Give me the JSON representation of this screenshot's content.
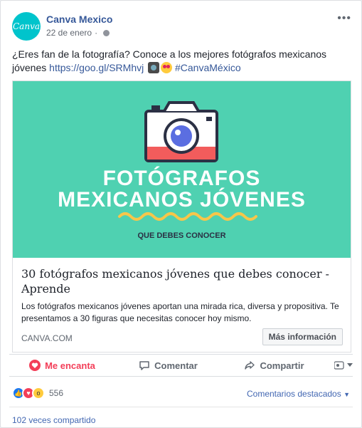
{
  "post": {
    "page_name": "Canva Mexico",
    "avatar_text": "Canva",
    "date": "22 de enero",
    "privacy_icon": "globe-icon",
    "menu_icon": "more-dots-icon",
    "text_intro": "¿Eres fan de la fotografía? Conoce a los mejores fotógrafos mexicanos jóvenes ",
    "text_link": "https://goo.gl/SRMhvj",
    "text_hashtag": "#CanvaMéxico"
  },
  "preview": {
    "image_line1": "FOTÓGRAFOS",
    "image_line2": "MEXICANOS JÓVENES",
    "image_subtitle": "QUE DEBES CONOCER",
    "title": "30 fotógrafos mexicanos jóvenes que debes conocer - Aprende",
    "description": "Los fotógrafos mexicanos jóvenes aportan una mirada rica, diversa y propositiva. Te presentamos a 30 figuras que necesitas conocer hoy mismo.",
    "domain": "CANVA.COM",
    "button_label": "Más información",
    "colors": {
      "bg": "#4fd1b1",
      "camera": "#2b3044",
      "accent": "#f25c5c",
      "wave": "#f7c64a"
    }
  },
  "actions": {
    "love": "Me encanta",
    "comment": "Comentar",
    "share": "Compartir"
  },
  "stats": {
    "reactions_count": "556",
    "featured_comments": "Comentarios destacados",
    "shares": "102 veces compartido"
  }
}
